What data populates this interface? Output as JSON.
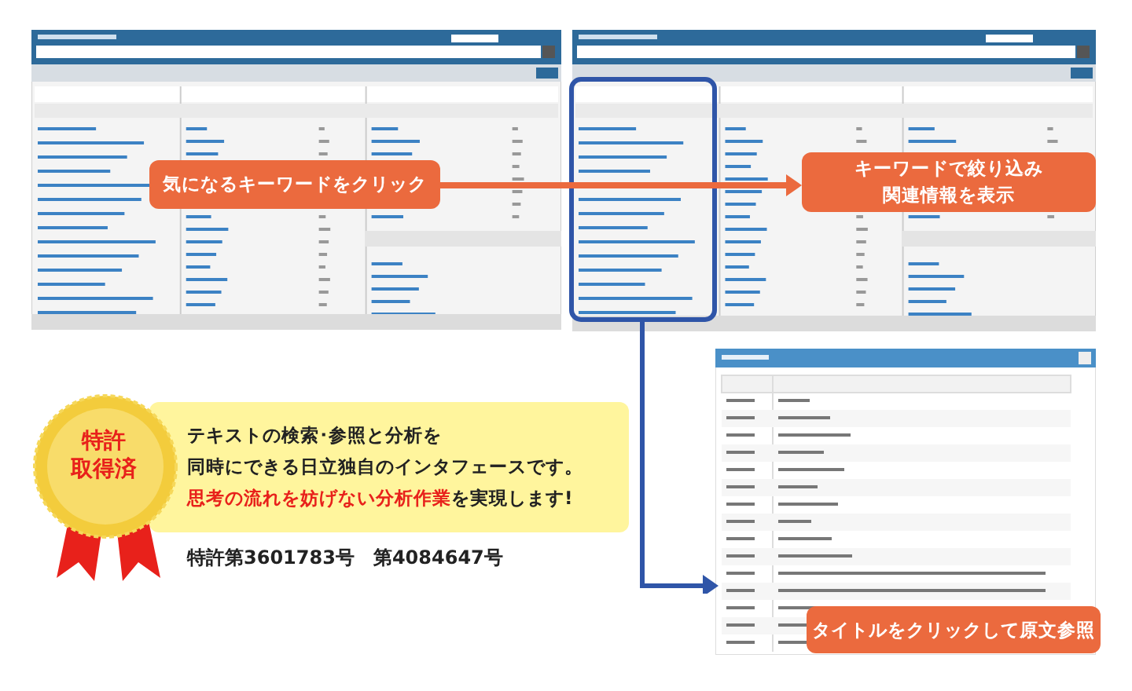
{
  "callouts": [
    {
      "lines": [
        "気になるキーワードをクリック"
      ]
    },
    {
      "lines": [
        "キーワードで絞り込み",
        "関連情報を表示"
      ]
    },
    {
      "lines": [
        "タイトルをクリックして原文参照"
      ]
    }
  ],
  "badge": {
    "lines": [
      "特許",
      "取得済"
    ]
  },
  "description": {
    "lines": [
      [
        {
          "text": "テキストの検索･参照と分析を",
          "emphasis": false
        }
      ],
      [
        {
          "text": "同時にできる日立独自のインタフェースです。",
          "emphasis": false
        }
      ],
      [
        {
          "text": "思考の流れを妨げない分析作業",
          "emphasis": true
        },
        {
          "text": "を実現します!",
          "emphasis": false
        }
      ]
    ]
  },
  "patents": "特許第3601783号　第4084647号"
}
